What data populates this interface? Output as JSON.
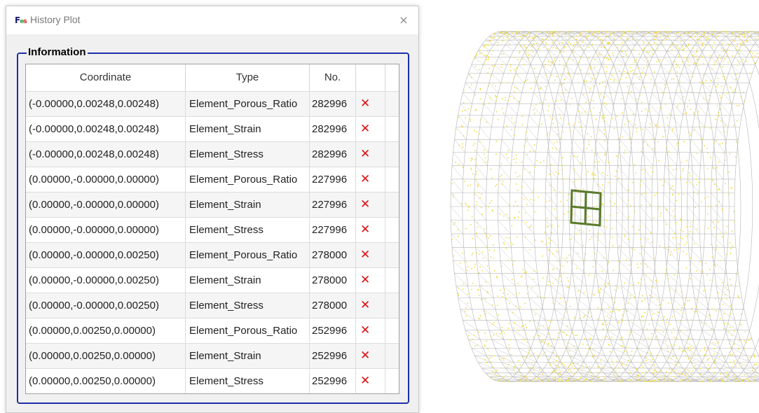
{
  "window": {
    "title": "History Plot",
    "logo_text": "F",
    "close_icon": "×"
  },
  "group": {
    "title": "Information"
  },
  "table": {
    "headers": {
      "coordinate": "Coordinate",
      "type": "Type",
      "no": "No.",
      "action": ""
    },
    "delete_icon": "✕",
    "rows": [
      {
        "coordinate": "(-0.00000,0.00248,0.00248)",
        "type": "Element_Porous_Ratio",
        "no": "282996"
      },
      {
        "coordinate": "(-0.00000,0.00248,0.00248)",
        "type": "Element_Strain",
        "no": "282996"
      },
      {
        "coordinate": "(-0.00000,0.00248,0.00248)",
        "type": "Element_Stress",
        "no": "282996"
      },
      {
        "coordinate": "(0.00000,-0.00000,0.00000)",
        "type": "Element_Porous_Ratio",
        "no": "227996"
      },
      {
        "coordinate": "(0.00000,-0.00000,0.00000)",
        "type": "Element_Strain",
        "no": "227996"
      },
      {
        "coordinate": "(0.00000,-0.00000,0.00000)",
        "type": "Element_Stress",
        "no": "227996"
      },
      {
        "coordinate": "(0.00000,-0.00000,0.00250)",
        "type": "Element_Porous_Ratio",
        "no": "278000"
      },
      {
        "coordinate": "(0.00000,-0.00000,0.00250)",
        "type": "Element_Strain",
        "no": "278000"
      },
      {
        "coordinate": "(0.00000,-0.00000,0.00250)",
        "type": "Element_Stress",
        "no": "278000"
      },
      {
        "coordinate": "(0.00000,0.00250,0.00000)",
        "type": "Element_Porous_Ratio",
        "no": "252996"
      },
      {
        "coordinate": "(0.00000,0.00250,0.00000)",
        "type": "Element_Strain",
        "no": "252996"
      },
      {
        "coordinate": "(0.00000,0.00250,0.00000)",
        "type": "Element_Stress",
        "no": "252996"
      }
    ]
  },
  "colors": {
    "group_border": "#1e2fa8",
    "delete": "#e01010",
    "mesh_line": "#b4b4b4",
    "mesh_node": "#f0d838",
    "selected_element": "#5a7a2a"
  }
}
